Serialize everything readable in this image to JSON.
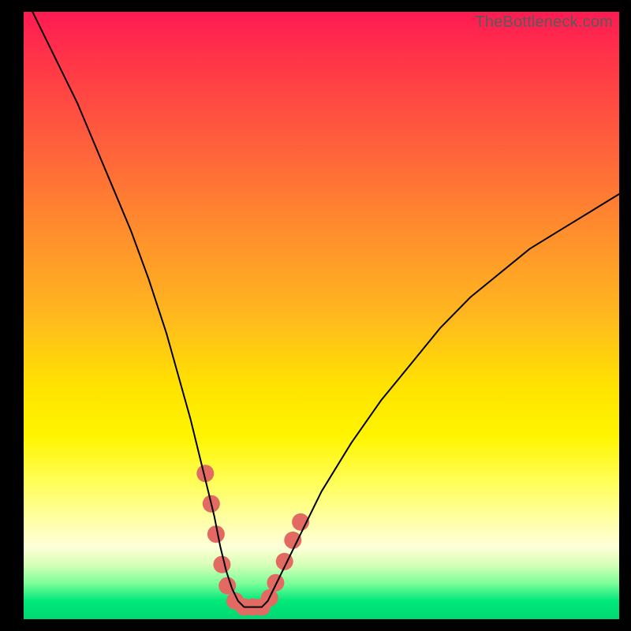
{
  "watermark": "TheBottleneck.com",
  "colors": {
    "frame_border": "#000000",
    "curve": "#000000",
    "marker": "#e26a63",
    "gradient_top": "#ff1a53",
    "gradient_bottom": "#00d873"
  },
  "chart_data": {
    "type": "line",
    "title": "",
    "xlabel": "",
    "ylabel": "",
    "xlim": [
      0,
      100
    ],
    "ylim": [
      0,
      100
    ],
    "series": [
      {
        "name": "bottleneck-curve",
        "x": [
          0,
          3,
          6,
          9,
          12,
          15,
          18,
          21,
          24,
          26,
          28,
          30,
          31,
          32,
          33,
          34,
          35,
          36,
          37,
          38,
          39,
          40,
          41,
          42,
          44,
          47,
          50,
          55,
          60,
          65,
          70,
          75,
          80,
          85,
          90,
          95,
          100
        ],
        "y": [
          103,
          97,
          91,
          85,
          78,
          71,
          64,
          56,
          47,
          40,
          33,
          25,
          21,
          17,
          12,
          8,
          5,
          3,
          2,
          2,
          2,
          2,
          3,
          5,
          9,
          15,
          21,
          29,
          36,
          42,
          48,
          53,
          57,
          61,
          64,
          67,
          70
        ]
      }
    ],
    "markers": {
      "name": "highlighted-points",
      "points": [
        {
          "x": 30.5,
          "y": 24
        },
        {
          "x": 31.5,
          "y": 19
        },
        {
          "x": 32.3,
          "y": 14
        },
        {
          "x": 33.3,
          "y": 9
        },
        {
          "x": 34.2,
          "y": 5.5
        },
        {
          "x": 35.5,
          "y": 3
        },
        {
          "x": 37.0,
          "y": 2
        },
        {
          "x": 38.5,
          "y": 2
        },
        {
          "x": 40.0,
          "y": 2
        },
        {
          "x": 41.3,
          "y": 3.5
        },
        {
          "x": 42.3,
          "y": 6
        },
        {
          "x": 43.8,
          "y": 9.5
        },
        {
          "x": 45.2,
          "y": 13
        },
        {
          "x": 46.5,
          "y": 16
        }
      ]
    }
  }
}
